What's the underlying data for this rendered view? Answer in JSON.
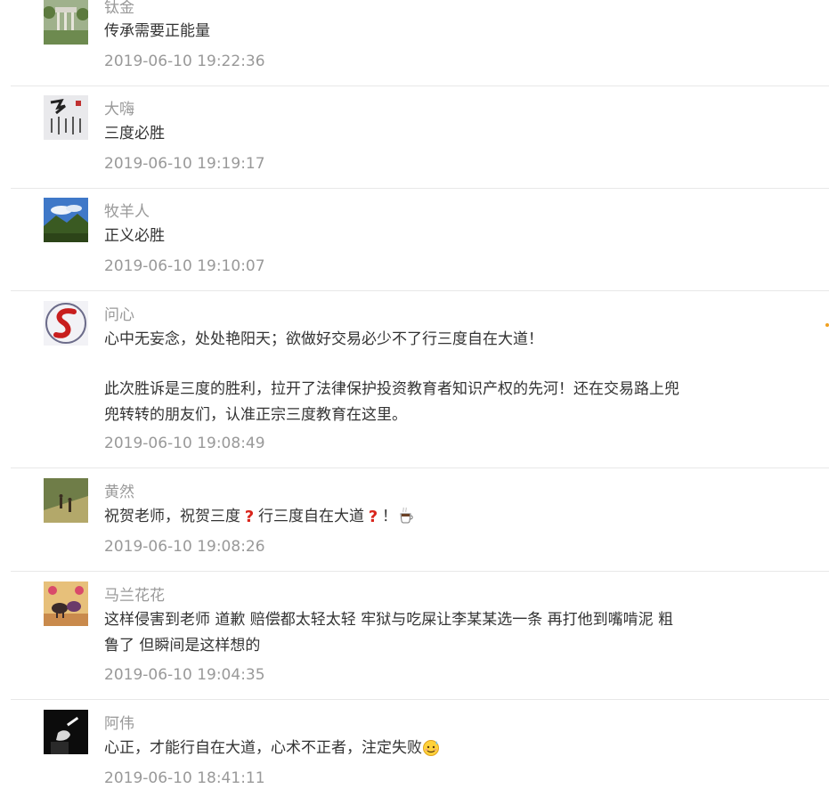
{
  "comments": [
    {
      "author": "钛金",
      "avatar_icon": "garden-pavilion-avatar",
      "content": [
        "传承需要正能量"
      ],
      "time": "2019-06-10 19:22:36"
    },
    {
      "author": "大嗨",
      "avatar_icon": "calligraphy-scroll-avatar",
      "content": [
        "三度必胜"
      ],
      "time": "2019-06-10 19:19:17"
    },
    {
      "author": "牧羊人",
      "avatar_icon": "mountain-sky-avatar",
      "content": [
        "正义必胜"
      ],
      "time": "2019-06-10 19:10:07"
    },
    {
      "author": "问心",
      "avatar_icon": "red-s-logo-avatar",
      "content": [
        "心中无妄念，处处艳阳天；欲做好交易必少不了行三度自在大道！",
        "此次胜诉是三度的胜利，拉开了法律保护投资教育者知识产权的先河！还在交易路上兜兜转转的朋友们，认准正宗三度教育在这里。"
      ],
      "time": "2019-06-10 19:08:49"
    },
    {
      "author": "黄然",
      "avatar_icon": "hikers-hillside-avatar",
      "content_parts": [
        "祝贺老师，祝贺三度",
        "行三度自在大道",
        "！"
      ],
      "emojis": [
        "red-question-mark-icon",
        "red-question-mark-icon",
        "coffee-cup-icon"
      ],
      "time": "2019-06-10 19:08:26"
    },
    {
      "author": "马兰花花",
      "avatar_icon": "folk-painting-animals-avatar",
      "content": [
        "这样侵害到老师 道歉 赔偿都太轻太轻 牢狱与吃屎让李某某选一条 再打他到嘴啃泥 粗鲁了 但瞬间是这样想的"
      ],
      "time": "2019-06-10 19:04:35"
    },
    {
      "author": "阿伟",
      "avatar_icon": "cigarette-hand-avatar",
      "content_text": "心正，才能行自在大道，心术不正者，注定失败",
      "emoji": "sweat-smile-face-icon",
      "time": "2019-06-10 18:41:11"
    }
  ],
  "colors": {
    "author": "#999999",
    "time": "#999999",
    "content": "#333333",
    "divider": "#e8e8e8",
    "emoji_red": "#d9251c"
  }
}
